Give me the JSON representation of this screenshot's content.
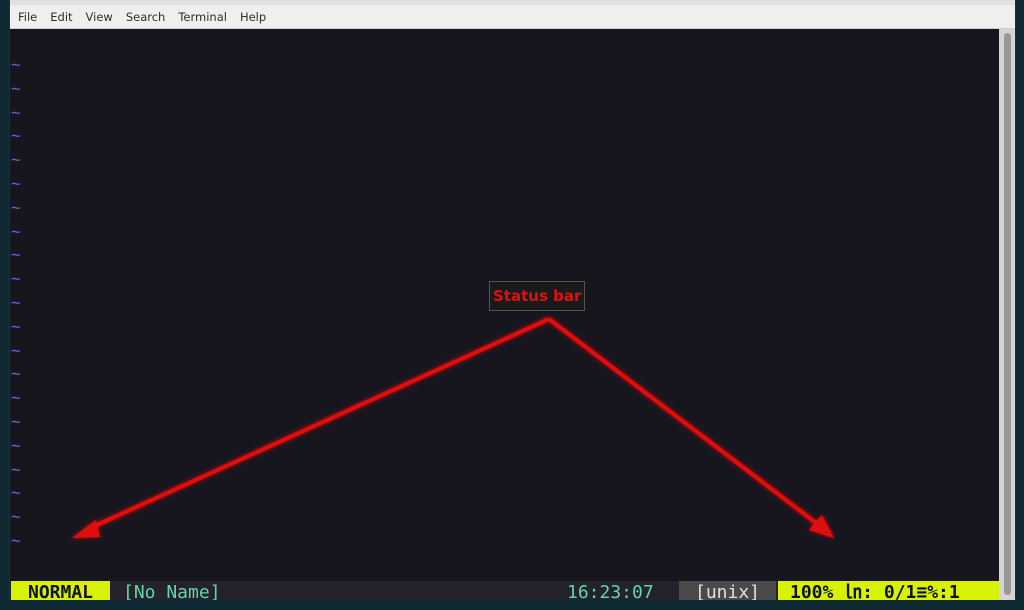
{
  "menubar": {
    "items": [
      "File",
      "Edit",
      "View",
      "Search",
      "Terminal",
      "Help"
    ]
  },
  "editor": {
    "empty_line_marker": "~",
    "empty_line_count": 21,
    "marker_color": "#5b6ad8"
  },
  "statusbar": {
    "mode": "NORMAL",
    "filename": "[No Name]",
    "clock": "16:23:07",
    "file_format": "[unix]",
    "position": "100% ㏑: 0/1≡%:1",
    "mode_bg": "#d7f205",
    "text_accent": "#5fd7a7"
  },
  "annotation": {
    "label": "Status bar",
    "color": "#e01010"
  }
}
